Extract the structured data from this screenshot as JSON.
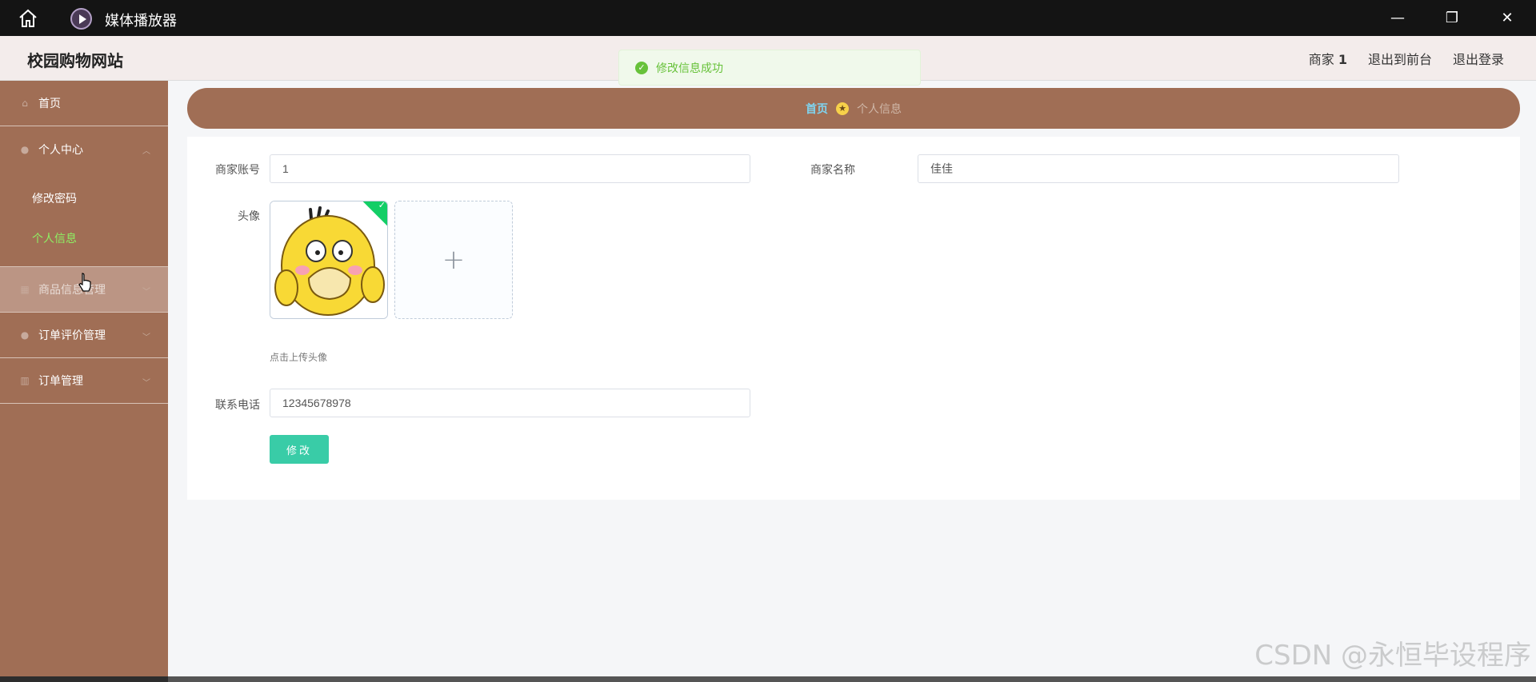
{
  "window": {
    "title": "媒体播放器",
    "minimize_label": "—",
    "maximize_label": "❐",
    "close_label": "✕"
  },
  "header": {
    "site_title": "校园购物网站",
    "user_role": "商家",
    "user_id": "1",
    "to_front_label": "退出到前台",
    "logout_label": "退出登录"
  },
  "toast": {
    "message": "修改信息成功",
    "icon": "check-circle-icon",
    "color": "#67c23a"
  },
  "sidebar": {
    "items": [
      {
        "label": "首页",
        "icon": "home-icon"
      },
      {
        "label": "个人中心",
        "icon": "user-icon",
        "expanded": true,
        "children": [
          {
            "label": "修改密码",
            "active": false
          },
          {
            "label": "个人信息",
            "active": true
          }
        ]
      },
      {
        "label": "商品信息管理",
        "icon": "goods-icon",
        "hovered": true
      },
      {
        "label": "订单评价管理",
        "icon": "user-icon"
      },
      {
        "label": "订单管理",
        "icon": "chart-icon"
      }
    ],
    "bg_color": "#a06e55",
    "active_color": "#8ef063"
  },
  "breadcrumb": {
    "home": "首页",
    "separator_icon": "star-icon",
    "current": "个人信息"
  },
  "form": {
    "account_label": "商家账号",
    "account_value": "1",
    "name_label": "商家名称",
    "name_value": "佳佳",
    "avatar_label": "头像",
    "upload_plus": "+",
    "upload_hint": "点击上传头像",
    "phone_label": "联系电话",
    "phone_value": "12345678978",
    "submit_label": "修改"
  },
  "watermark": "CSDN @永恒毕设程序"
}
